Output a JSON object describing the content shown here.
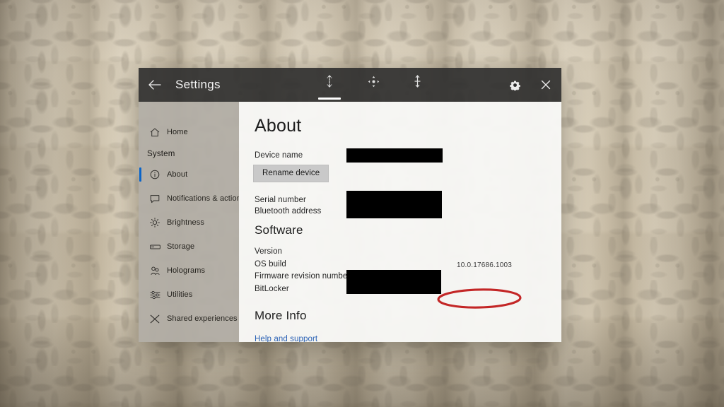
{
  "window": {
    "title": "Settings",
    "back_icon": "back-arrow-icon",
    "appbar_tools": [
      {
        "name": "scale-tool-icon",
        "label": "Scale",
        "selected": true
      },
      {
        "name": "move-tool-icon",
        "label": "Move",
        "selected": false
      },
      {
        "name": "adjust-tool-icon",
        "label": "Adjust",
        "selected": false
      }
    ],
    "right_buttons": [
      {
        "name": "settings-gear-icon",
        "label": "Settings"
      },
      {
        "name": "close-icon",
        "label": "Close"
      }
    ]
  },
  "sidebar": {
    "items": [
      {
        "label": "Home",
        "icon": "home-icon",
        "selected": false
      },
      {
        "label": "About",
        "icon": "info-circle-icon",
        "selected": true
      },
      {
        "label": "Notifications & actions",
        "icon": "notification-icon",
        "selected": false
      },
      {
        "label": "Brightness",
        "icon": "brightness-icon",
        "selected": false
      },
      {
        "label": "Storage",
        "icon": "storage-icon",
        "selected": false
      },
      {
        "label": "Holograms",
        "icon": "holograms-icon",
        "selected": false
      },
      {
        "label": "Utilities",
        "icon": "utilities-icon",
        "selected": false
      },
      {
        "label": "Shared experiences",
        "icon": "shared-experiences-icon",
        "selected": false
      }
    ],
    "section_label": "System"
  },
  "main": {
    "page_title": "About",
    "device": {
      "name_label": "Device name",
      "rename_button": "Rename device",
      "serial_label": "Serial number",
      "bluetooth_label": "Bluetooth address"
    },
    "software": {
      "heading": "Software",
      "version_label": "Version",
      "os_build_label": "OS build",
      "os_build_value": "10.0.17686.1003",
      "firmware_label": "Firmware revision number",
      "bitlocker_label": "BitLocker"
    },
    "more_info": {
      "heading": "More Info",
      "help_link": "Help and support"
    }
  },
  "annotation": {
    "shape": "ellipse",
    "target": "os-build-value",
    "color": "#c32626"
  },
  "colors": {
    "accent_blue": "#0a64c8",
    "link_blue": "#2b62b5",
    "annotation_red": "#c32626",
    "titlebar": "#2c2c2c",
    "sidebar": "#b1ada6",
    "content": "#f7f7f5",
    "redaction": "#000000"
  }
}
